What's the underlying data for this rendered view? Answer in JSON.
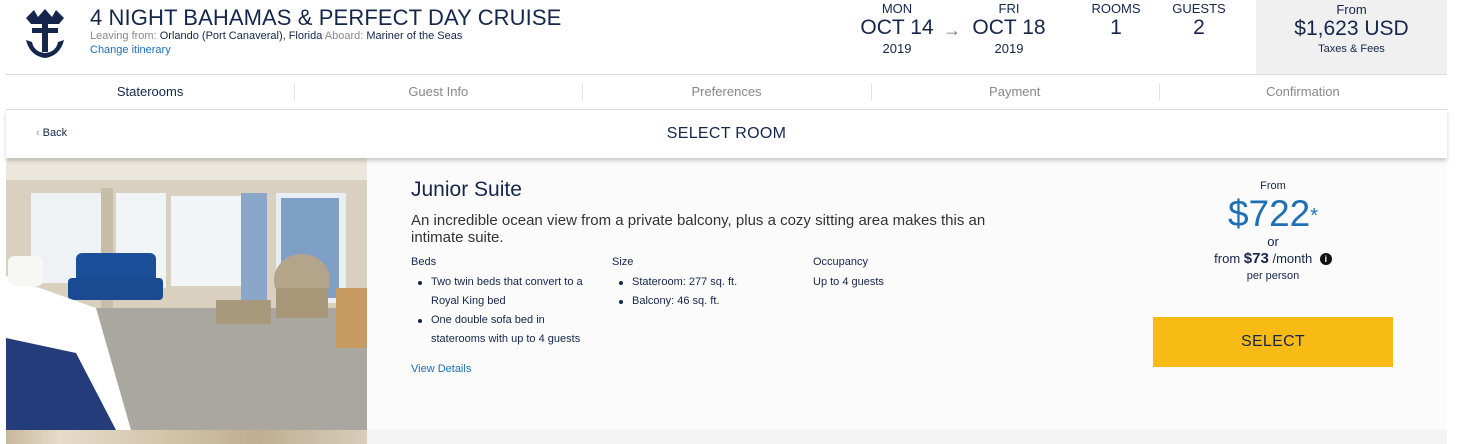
{
  "header": {
    "title": "4 NIGHT BAHAMAS & PERFECT DAY CRUISE",
    "leaving_label": "Leaving from:",
    "leaving_value": "Orlando (Port Canaveral), Florida",
    "aboard_label": "Aboard:",
    "aboard_value": "Mariner of the Seas",
    "change_itinerary": "Change itinerary",
    "depart": {
      "dow": "MON",
      "date": "OCT 14",
      "year": "2019"
    },
    "arrow": "→",
    "return": {
      "dow": "FRI",
      "date": "OCT 18",
      "year": "2019"
    },
    "rooms_label": "ROOMS",
    "rooms_value": "1",
    "guests_label": "GUESTS",
    "guests_value": "2",
    "price_from": "From",
    "price_amount": "$1,623 USD",
    "price_note": "Taxes & Fees"
  },
  "steps": [
    {
      "label": "Staterooms",
      "active": true
    },
    {
      "label": "Guest Info",
      "active": false
    },
    {
      "label": "Preferences",
      "active": false
    },
    {
      "label": "Payment",
      "active": false
    },
    {
      "label": "Confirmation",
      "active": false
    }
  ],
  "select_bar": {
    "back_label": "Back",
    "title": "SELECT ROOM"
  },
  "room": {
    "name": "Junior Suite",
    "description": "An incredible ocean view from a private balcony, plus a cozy sitting area makes this an intimate suite.",
    "beds_label": "Beds",
    "beds": [
      "Two twin beds that convert to a Royal King bed",
      "One double sofa bed in staterooms with up to 4 guests"
    ],
    "size_label": "Size",
    "size": [
      "Stateroom: 277 sq. ft.",
      "Balcony: 46 sq. ft."
    ],
    "occupancy_label": "Occupancy",
    "occupancy": "Up to 4 guests",
    "view_details": "View Details",
    "from_label": "From",
    "price": "$722",
    "price_mark": "*",
    "or": "or",
    "monthly_prefix": "from",
    "monthly_amount": "$73",
    "monthly_suffix": "/month",
    "per_person": "per person",
    "select_label": "SELECT"
  },
  "colors": {
    "navy": "#15264c",
    "link_blue": "#1f6fb5",
    "select_yellow": "#f8bb16"
  },
  "icons": [
    "crown-anchor-logo",
    "chevron-left-icon",
    "info-icon",
    "arrow-right-icon"
  ]
}
